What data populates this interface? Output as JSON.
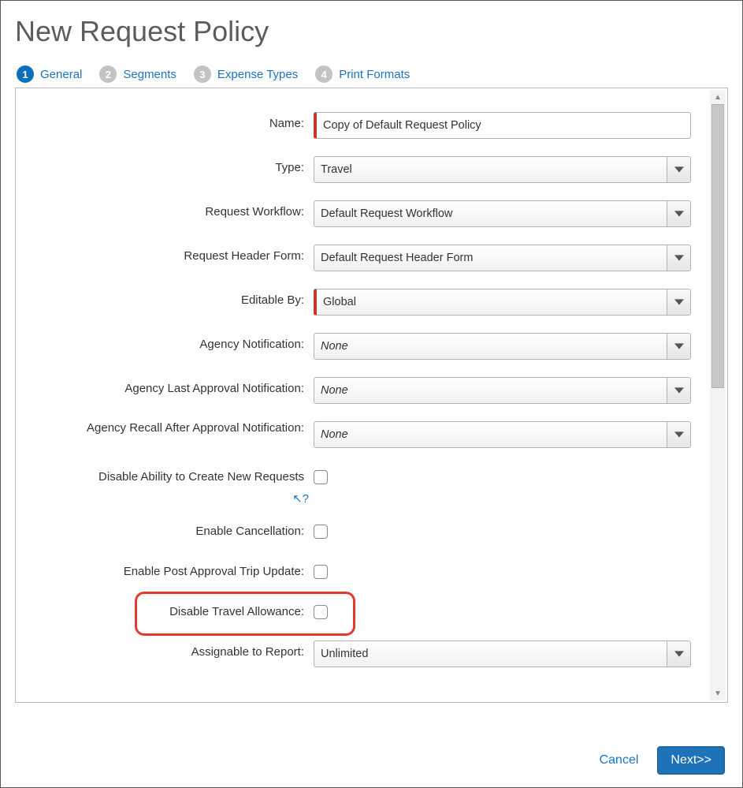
{
  "pageTitle": "New Request Policy",
  "wizard": [
    {
      "num": "1",
      "label": "General"
    },
    {
      "num": "2",
      "label": "Segments"
    },
    {
      "num": "3",
      "label": "Expense Types"
    },
    {
      "num": "4",
      "label": "Print Formats"
    }
  ],
  "form": {
    "name": {
      "label": "Name:",
      "value": "Copy of Default Request Policy"
    },
    "type": {
      "label": "Type:",
      "value": "Travel"
    },
    "workflow": {
      "label": "Request Workflow:",
      "value": "Default Request Workflow"
    },
    "headerForm": {
      "label": "Request Header Form:",
      "value": "Default Request Header Form"
    },
    "editableBy": {
      "label": "Editable By:",
      "value": "Global"
    },
    "agencyNotif": {
      "label": "Agency Notification:",
      "value": "None"
    },
    "agencyLastNotif": {
      "label": "Agency Last Approval Notification:",
      "value": "None"
    },
    "agencyRecallNotif": {
      "label": "Agency Recall After Approval Notification:",
      "value": "None"
    },
    "disableCreate": {
      "label": "Disable Ability to Create New Requests",
      "checked": false
    },
    "helpCursor": "↖?",
    "enableCancel": {
      "label": "Enable Cancellation:",
      "checked": false
    },
    "enablePostTrip": {
      "label": "Enable Post Approval Trip Update:",
      "checked": false
    },
    "disableTA": {
      "label": "Disable Travel Allowance:",
      "checked": false
    },
    "assignable": {
      "label": "Assignable to Report:",
      "value": "Unlimited"
    }
  },
  "footer": {
    "cancel": "Cancel",
    "next": "Next>>"
  }
}
